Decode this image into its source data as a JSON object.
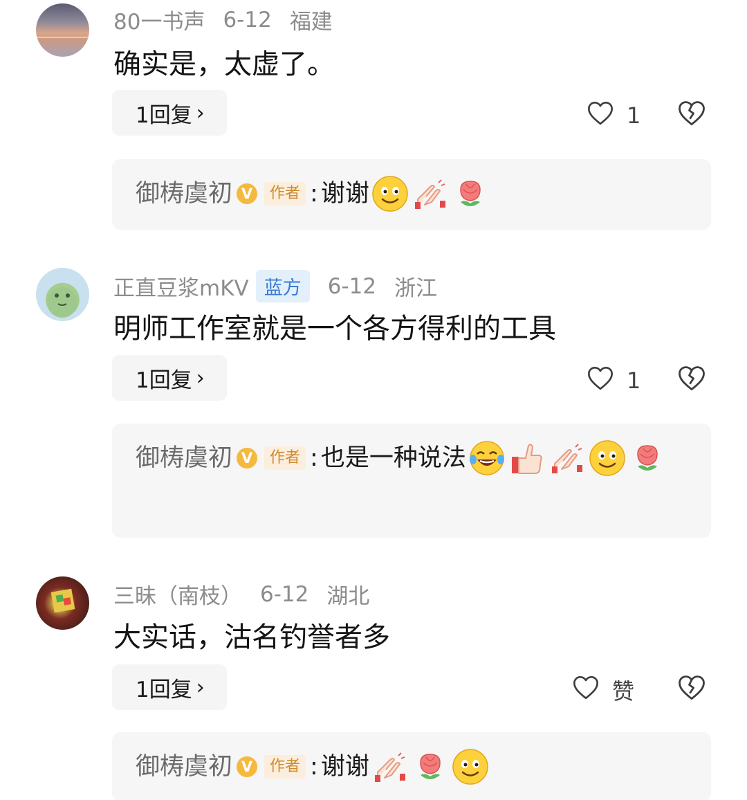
{
  "comments": [
    {
      "user": "80一书声",
      "tag": "",
      "date": "6-12",
      "location": "福建",
      "text": "确实是，太虚了。",
      "reply_label": "1回复",
      "like_count": "1",
      "author_reply": {
        "name": "御梼虞初",
        "tag": "作者",
        "text": "谢谢",
        "emojis": [
          "smile-emoji",
          "clap-emoji",
          "rose-emoji"
        ]
      }
    },
    {
      "user": "正直豆浆mKV",
      "tag": "蓝方",
      "date": "6-12",
      "location": "浙江",
      "text": "明师工作室就是一个各方得利的工具",
      "reply_label": "1回复",
      "like_count": "1",
      "author_reply": {
        "name": "御梼虞初",
        "tag": "作者",
        "text": "也是一种说法",
        "emojis": [
          "laugh-cry-emoji",
          "thumbs-up-emoji",
          "clap-emoji",
          "smile-emoji",
          "rose-emoji"
        ]
      }
    },
    {
      "user": "三昧（南枝）",
      "tag": "",
      "date": "6-12",
      "location": "湖北",
      "text": "大实话，沽名钓誉者多",
      "reply_label": "1回复",
      "like_count": "赞",
      "author_reply": {
        "name": "御梼虞初",
        "tag": "作者",
        "text": "谢谢",
        "emojis": [
          "clap-emoji",
          "rose-emoji",
          "smile-emoji"
        ]
      }
    }
  ],
  "icons": {
    "like": "heart-outline-icon",
    "dislike": "broken-heart-icon",
    "chevron": "chevron-right-icon",
    "verified": "verified-v-icon"
  },
  "chevron_glyph": "›",
  "verified_glyph": "V",
  "colors": {
    "meta": "#8c8c8c",
    "blue_tag_bg": "#e3effb",
    "blue_tag_text": "#3a7bd5",
    "author_tag_bg": "#fbeedd",
    "author_tag_text": "#d08a2c",
    "verified": "#f5b93d",
    "reply_bg": "#f6f6f6"
  }
}
